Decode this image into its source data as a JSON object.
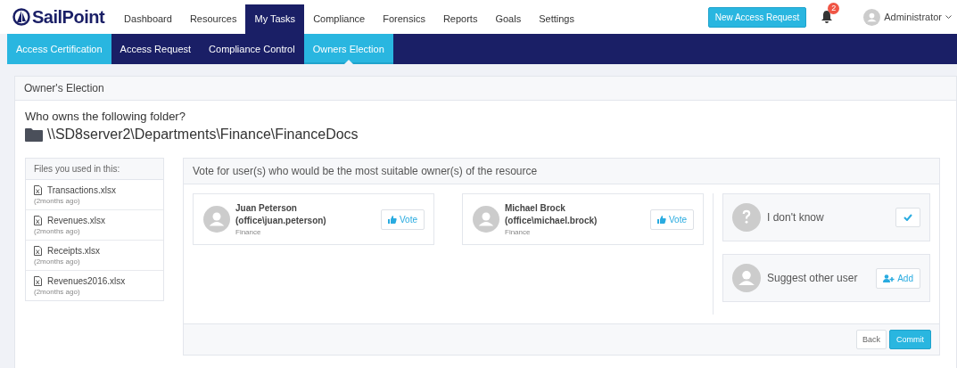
{
  "brand": {
    "name": "SailPoint"
  },
  "nav": [
    {
      "label": "Dashboard",
      "selected": false
    },
    {
      "label": "Resources",
      "selected": false
    },
    {
      "label": "My Tasks",
      "selected": true
    },
    {
      "label": "Compliance",
      "selected": false
    },
    {
      "label": "Forensics",
      "selected": false
    },
    {
      "label": "Reports",
      "selected": false
    },
    {
      "label": "Goals",
      "selected": false
    },
    {
      "label": "Settings",
      "selected": false
    }
  ],
  "header_actions": {
    "new_request": "New Access Request",
    "notifications": "2",
    "user": "Administrator"
  },
  "subnav": [
    {
      "label": "Access Certification",
      "highlighted": true,
      "selected": false
    },
    {
      "label": "Access Request",
      "highlighted": false,
      "selected": false
    },
    {
      "label": "Compliance Control",
      "highlighted": false,
      "selected": false
    },
    {
      "label": "Owners Election",
      "highlighted": true,
      "selected": true
    }
  ],
  "panel": {
    "title": "Owner's Election",
    "question": "Who owns the following folder?",
    "path": "\\\\SD8server2\\Departments\\Finance\\FinanceDocs"
  },
  "files": {
    "title": "Files you used in this:",
    "items": [
      {
        "name": "Transactions.xlsx",
        "time": "(2months ago)"
      },
      {
        "name": "Revenues.xlsx",
        "time": "(2months ago)"
      },
      {
        "name": "Receipts.xlsx",
        "time": "(2months ago)"
      },
      {
        "name": "Revenues2016.xlsx",
        "time": "(2months ago)"
      }
    ]
  },
  "vote": {
    "title": "Vote for user(s) who would be the most suitable owner(s) of the resource",
    "candidates": [
      {
        "name": "Juan Peterson",
        "account": "(office\\juan.peterson)",
        "department": "Finance",
        "button": "Vote"
      },
      {
        "name": "Michael Brock",
        "account": "(office\\michael.brock)",
        "department": "Finance",
        "button": "Vote"
      }
    ],
    "options": [
      {
        "kind": "unknown",
        "label": "I don't know"
      },
      {
        "kind": "suggest",
        "label": "Suggest other user",
        "button": "Add"
      }
    ],
    "buttons": [
      "Back",
      "Commit"
    ]
  }
}
